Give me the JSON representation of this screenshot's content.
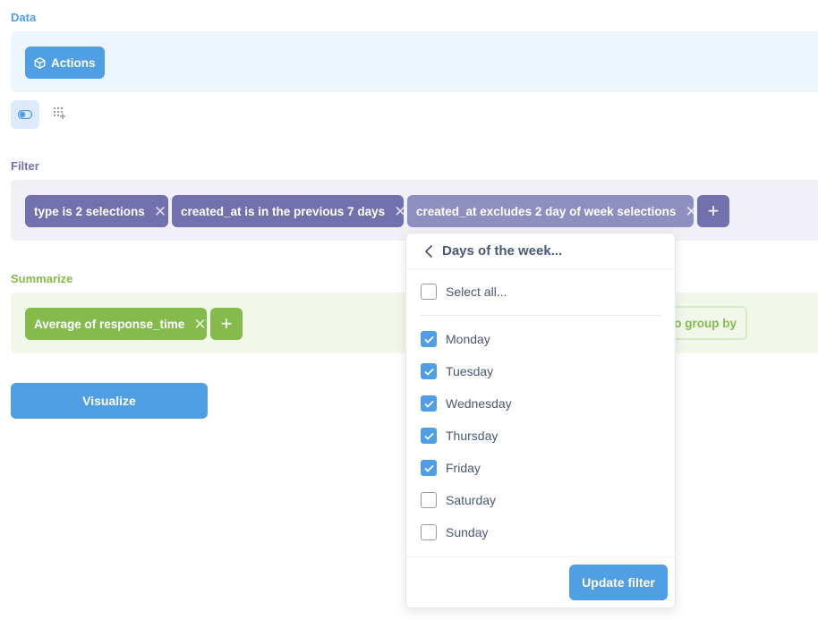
{
  "sections": {
    "data_label": "Data",
    "filter_label": "Filter",
    "summarize_label": "Summarize"
  },
  "data": {
    "source_label": "Actions",
    "source_icon": "cube-icon"
  },
  "filter": {
    "pills": [
      {
        "label": "type is 2 selections"
      },
      {
        "label": "created_at is in the previous 7 days"
      },
      {
        "label": "created_at excludes 2 day of week selections"
      }
    ],
    "add_icon": "plus-icon"
  },
  "summarize": {
    "metric_label": "Average of response_time",
    "group_by_label": "to group by",
    "add_icon": "plus-icon"
  },
  "visualize_label": "Visualize",
  "popover": {
    "title": "Days of the week...",
    "select_all_label": "Select all...",
    "select_all_checked": false,
    "days": [
      {
        "label": "Monday",
        "checked": true
      },
      {
        "label": "Tuesday",
        "checked": true
      },
      {
        "label": "Wednesday",
        "checked": true
      },
      {
        "label": "Thursday",
        "checked": true
      },
      {
        "label": "Friday",
        "checked": true
      },
      {
        "label": "Saturday",
        "checked": false
      },
      {
        "label": "Sunday",
        "checked": false
      }
    ],
    "update_label": "Update filter"
  },
  "colors": {
    "data_accent": "#509ee3",
    "filter_accent": "#7172ad",
    "summarize_accent": "#84bb4c"
  }
}
